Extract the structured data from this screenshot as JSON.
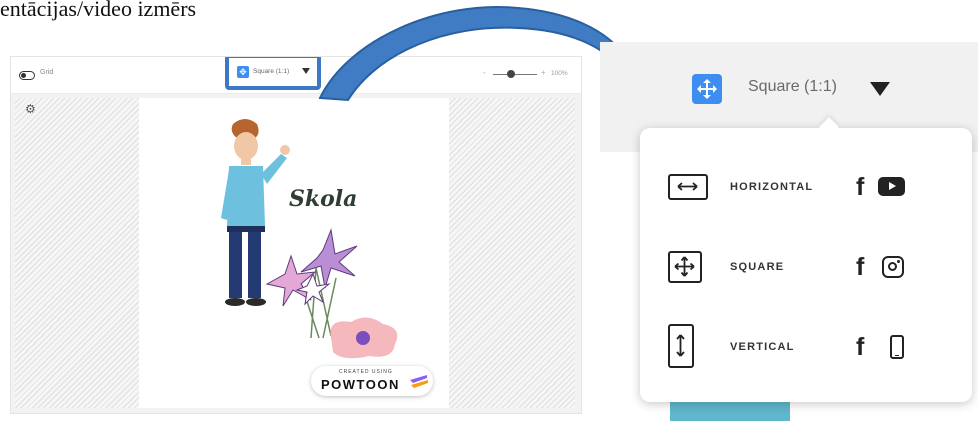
{
  "caption": "entācijas/video izmērs",
  "editor": {
    "grid_label": "Grid",
    "format_label": "Square (1:1)",
    "zoom_minus": "-",
    "zoom_plus": "+",
    "zoom_percent": "100%",
    "canvas_text": "Skola",
    "badge": {
      "created_using": "CREATED USING",
      "brand": "POWTOON"
    }
  },
  "dropdown": {
    "selected_label": "Square (1:1)",
    "options": [
      {
        "label": "HORIZONTAL",
        "icon": "horizontal-arrows-icon",
        "platform_icons": [
          "facebook-icon",
          "youtube-icon"
        ]
      },
      {
        "label": "SQUARE",
        "icon": "move-arrows-icon",
        "platform_icons": [
          "facebook-icon",
          "instagram-icon"
        ]
      },
      {
        "label": "VERTICAL",
        "icon": "vertical-arrows-icon",
        "platform_icons": [
          "facebook-icon",
          "phone-icon"
        ]
      }
    ]
  },
  "colors": {
    "accent_blue": "#3d8ef0",
    "highlight_border": "#3d78c4",
    "arrow_blue": "#3f7cc4"
  }
}
